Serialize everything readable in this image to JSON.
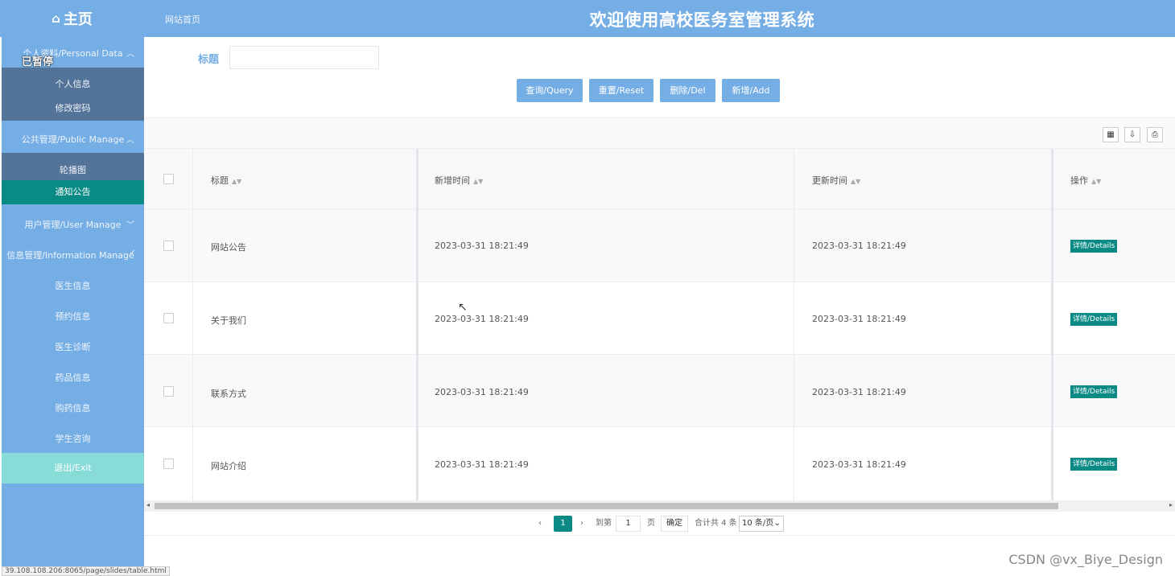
{
  "header": {
    "home_label": "主页",
    "breadcrumb": "网站首页",
    "system_title": "欢迎使用高校医务室管理系统"
  },
  "overlay": {
    "paused": "已暂停"
  },
  "sidebar": {
    "group_personal": "个人资料/Personal Data",
    "personal_items": [
      "个人信息",
      "修改密码"
    ],
    "group_public": "公共管理/Public Manage",
    "public_items": [
      "轮播图",
      "通知公告"
    ],
    "group_user": "用户管理/User Manage",
    "group_info": "信息管理/Information Manage",
    "info_items": [
      "医生信息",
      "预约信息",
      "医生诊断",
      "药品信息",
      "购药信息",
      "学生咨询"
    ],
    "exit": "退出/Exit"
  },
  "search": {
    "label": "标题",
    "value": "",
    "buttons": {
      "query": "查询/Query",
      "reset": "重置/Reset",
      "delete": "删除/Del",
      "add": "新增/Add"
    }
  },
  "table": {
    "columns": [
      "标题",
      "新增时间",
      "更新时间",
      "操作"
    ],
    "rows": [
      {
        "title": "网站公告",
        "created": "2023-03-31 18:21:49",
        "updated": "2023-03-31 18:21:49",
        "action": "详情/Details"
      },
      {
        "title": "关于我们",
        "created": "2023-03-31 18:21:49",
        "updated": "2023-03-31 18:21:49",
        "action": "详情/Details"
      },
      {
        "title": "联系方式",
        "created": "2023-03-31 18:21:49",
        "updated": "2023-03-31 18:21:49",
        "action": "详情/Details"
      },
      {
        "title": "网站介绍",
        "created": "2023-03-31 18:21:49",
        "updated": "2023-03-31 18:21:49",
        "action": "详情/Details"
      }
    ]
  },
  "pagination": {
    "current_page": "1",
    "goto_label": "到第",
    "goto_value": "1",
    "page_unit": "页",
    "confirm": "确定",
    "total": "合计共 4 条",
    "page_size": "10 条/页"
  },
  "status_url": "39.108.108.206:8065/page/slides/table.html",
  "watermark": "CSDN @vx_Biye_Design",
  "colors": {
    "header": "#75aee5",
    "accent": "#0a8a84",
    "submenu": "#537399",
    "exit": "#88dcd8"
  }
}
